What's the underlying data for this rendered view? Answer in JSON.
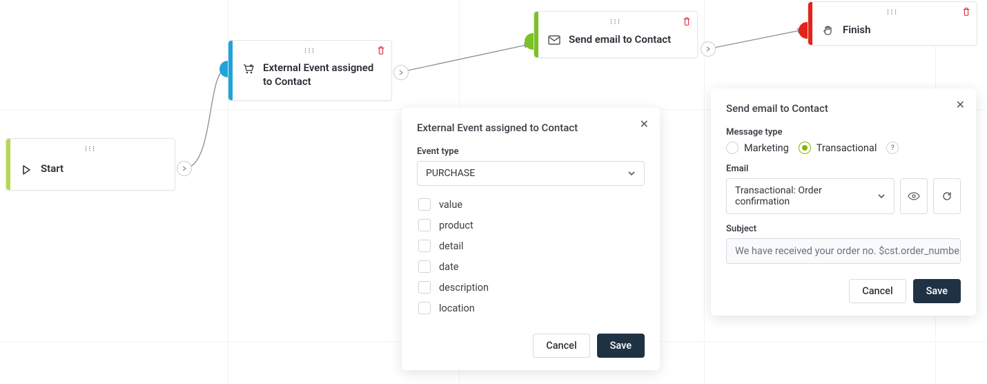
{
  "nodes": {
    "start": {
      "label": "Start",
      "stripe_color": "#b7d84e"
    },
    "external_event": {
      "label": "External Event assigned to Contact",
      "stripe_color": "#1ea4d8"
    },
    "send_email": {
      "label": "Send email to Contact",
      "stripe_color": "#7cc125"
    },
    "finish": {
      "label": "Finish",
      "stripe_color": "#e5231b"
    }
  },
  "popup_external": {
    "title": "External Event assigned to Contact",
    "event_type_label": "Event type",
    "event_type_value": "PURCHASE",
    "options": [
      "value",
      "product",
      "detail",
      "date",
      "description",
      "location"
    ],
    "cancel_label": "Cancel",
    "save_label": "Save"
  },
  "popup_send_email": {
    "title": "Send email to Contact",
    "message_type_label": "Message type",
    "message_type_options": {
      "marketing": "Marketing",
      "transactional": "Transactional"
    },
    "message_type_selected": "transactional",
    "email_label": "Email",
    "email_value": "Transactional: Order confirmation",
    "subject_label": "Subject",
    "subject_value": "We have received your order no. $cst.order_number",
    "cancel_label": "Cancel",
    "save_label": "Save"
  }
}
